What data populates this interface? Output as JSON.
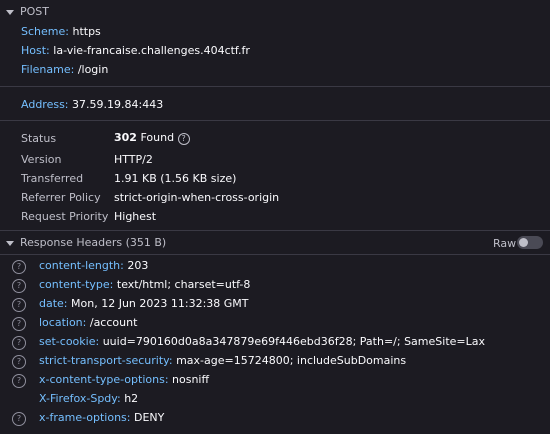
{
  "request": {
    "method": "POST",
    "scheme_label": "Scheme:",
    "scheme": "https",
    "host_label": "Host:",
    "host": "la-vie-francaise.challenges.404ctf.fr",
    "filename_label": "Filename:",
    "filename": "/login",
    "address_label": "Address:",
    "address": "37.59.19.84:443"
  },
  "summary": {
    "status_label": "Status",
    "status_code": "302",
    "status_text": "Found",
    "version_label": "Version",
    "version": "HTTP/2",
    "transferred_label": "Transferred",
    "transferred": "1.91 KB (1.56 KB size)",
    "referrer_label": "Referrer Policy",
    "referrer": "strict-origin-when-cross-origin",
    "priority_label": "Request Priority",
    "priority": "Highest"
  },
  "response_headers": {
    "title": "Response Headers (351 B)",
    "raw_label": "Raw",
    "raw_enabled": false,
    "rows": [
      {
        "name": "content-length:",
        "value": "203",
        "help": true
      },
      {
        "name": "content-type:",
        "value": "text/html; charset=utf-8",
        "help": true
      },
      {
        "name": "date:",
        "value": "Mon, 12 Jun 2023 11:32:38 GMT",
        "help": true
      },
      {
        "name": "location:",
        "value": "/account",
        "help": true
      },
      {
        "name": "set-cookie:",
        "value": "uuid=790160d0a8a347879e69f446ebd36f28; Path=/; SameSite=Lax",
        "help": true
      },
      {
        "name": "strict-transport-security:",
        "value": "max-age=15724800; includeSubDomains",
        "help": true
      },
      {
        "name": "x-content-type-options:",
        "value": "nosniff",
        "help": true
      },
      {
        "name": "X-Firefox-Spdy:",
        "value": "h2",
        "help": false
      },
      {
        "name": "x-frame-options:",
        "value": "DENY",
        "help": true
      }
    ]
  },
  "icons": {
    "expand": "chevron-down-icon",
    "help": "question-circle-icon"
  },
  "colors": {
    "background": "#1c1b22",
    "key": "#75bfff",
    "text": "#fbfbfe",
    "muted": "#bfbfc9"
  }
}
